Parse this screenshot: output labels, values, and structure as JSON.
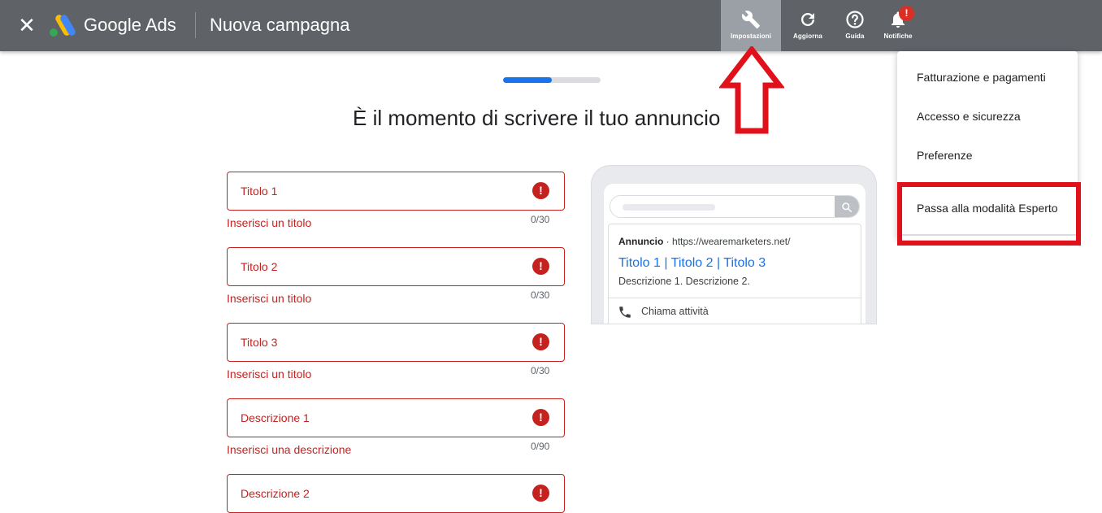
{
  "topbar": {
    "close_label": "✕",
    "brand": "Google Ads",
    "breadcrumb": "Nuova campagna",
    "tools": [
      {
        "label": "Impostazioni",
        "icon": "wrench-icon",
        "active": true
      },
      {
        "label": "Aggiorna",
        "icon": "refresh-icon"
      },
      {
        "label": "Guida",
        "icon": "help-icon"
      },
      {
        "label": "Notifiche",
        "icon": "bell-icon"
      }
    ],
    "notification_badge": "!"
  },
  "progress": {
    "fraction": 0.5
  },
  "main": {
    "heading": "È il momento di scrivere il tuo annuncio",
    "fields": [
      {
        "placeholder": "Titolo 1",
        "hint": "Inserisci un titolo",
        "count": "0/30"
      },
      {
        "placeholder": "Titolo 2",
        "hint": "Inserisci un titolo",
        "count": "0/30"
      },
      {
        "placeholder": "Titolo 3",
        "hint": "Inserisci un titolo",
        "count": "0/30"
      },
      {
        "placeholder": "Descrizione 1",
        "hint": "Inserisci una descrizione",
        "count": "0/90"
      },
      {
        "placeholder": "Descrizione 2"
      }
    ],
    "error_icon": "!"
  },
  "preview": {
    "ad_label": "Annuncio",
    "ad_sep": "·",
    "url": "https://wearemarketers.net/",
    "title": "Titolo 1 | Titolo 2 | Titolo 3",
    "description": "Descrizione 1. Descrizione 2.",
    "call": "Chiama attività"
  },
  "menu": {
    "items": [
      "Fatturazione e pagamenti",
      "Accesso e sicurezza",
      "Preferenze",
      "Passa alla modalità Esperto"
    ]
  },
  "colors": {
    "topbar": "#5f6368",
    "error": "#c5221f",
    "link": "#1a73e8",
    "highlight": "#e0111b"
  }
}
